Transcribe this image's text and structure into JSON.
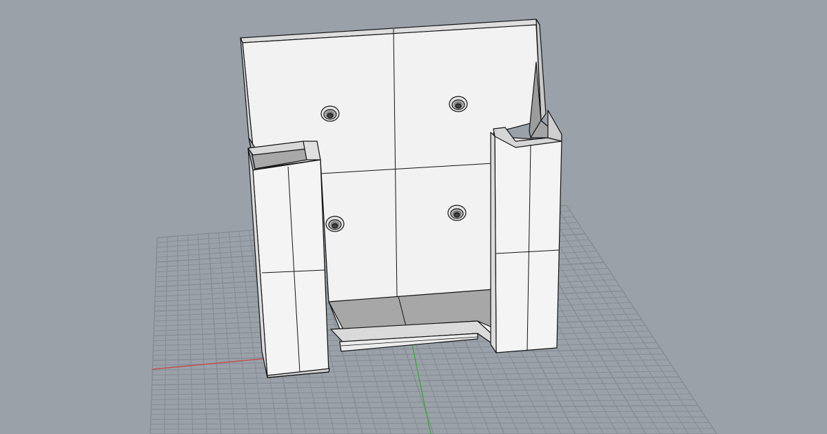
{
  "viewport": {
    "background": "#9aa1a9",
    "grid_color": "#858c94",
    "x_axis_color": "#c0504d",
    "y_axis_color": "#3faa3f"
  },
  "model": {
    "face_color": "#f2f2f2",
    "shadow_color": "#a9a9a9",
    "edge_color": "#111111",
    "screw_holes": 4
  }
}
